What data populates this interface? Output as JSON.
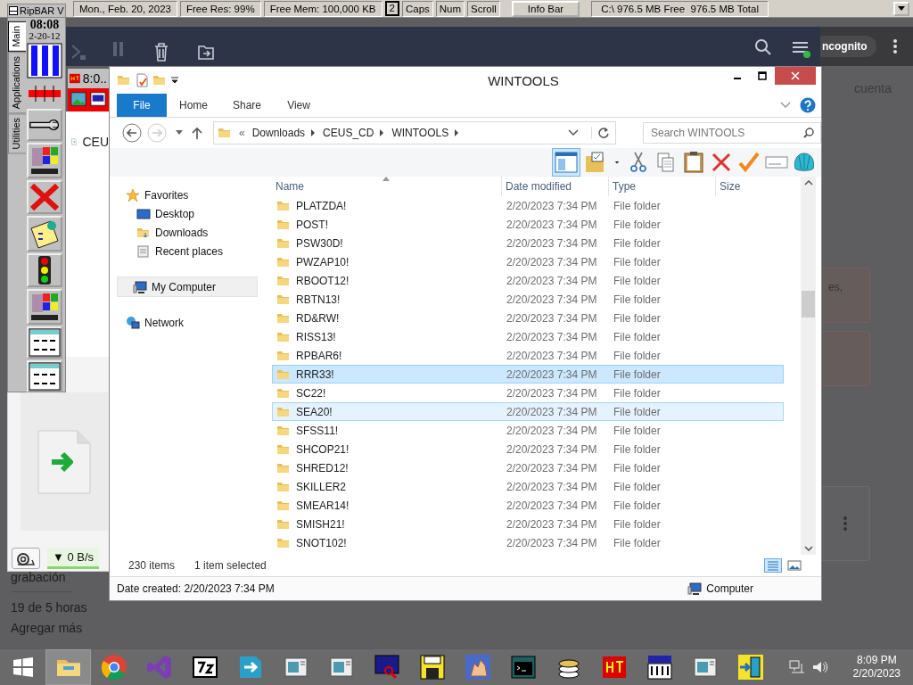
{
  "info_bar": {
    "segments": [
      {
        "text": "Mon., Feb. 20, 2023",
        "kind": "wide"
      },
      {
        "text": "Free Res: 99%",
        "kind": "wide"
      },
      {
        "text": "Free Mem: 100,000 KB",
        "kind": "wide"
      },
      {
        "text": "2",
        "kind": "counter"
      },
      {
        "text": "Caps",
        "kind": "key"
      },
      {
        "text": "Num",
        "kind": "key"
      },
      {
        "text": "Scroll",
        "kind": "key"
      },
      {
        "text": "Info Bar",
        "kind": "button"
      },
      {
        "text": "C:\\ 976.5 MB Free  976.5 MB Total",
        "kind": "wide"
      }
    ]
  },
  "background": {
    "incognito_label": "ncognito",
    "account_text": "cuenta",
    "card_text": "es,",
    "file_label": "CEU",
    "sidebar_texts": [
      "grabación",
      "19 de 5 horas",
      "Agregar más"
    ]
  },
  "hot_window": {
    "title": "8:0.."
  },
  "download_panel": {
    "speed": "▼ 0 B/s"
  },
  "ripbar": {
    "title": "RipBAR V",
    "clock": {
      "time": "08:08",
      "date": "2-20-12"
    },
    "tabs": [
      {
        "label": "Main",
        "selected": true
      },
      {
        "label": "Applications",
        "selected": false
      },
      {
        "label": "Utilities",
        "selected": false
      }
    ],
    "buttons": [
      {
        "kind": "meter"
      },
      {
        "kind": "redbar"
      },
      {
        "kind": "wrench"
      },
      {
        "kind": "windows"
      },
      {
        "kind": "cross"
      },
      {
        "kind": "note"
      },
      {
        "kind": "traffic"
      },
      {
        "kind": "windows"
      },
      {
        "kind": "form"
      },
      {
        "kind": "form"
      }
    ]
  },
  "explorer": {
    "title": "WINTOOLS",
    "ribbon_tabs": [
      {
        "label": "File",
        "selected": true
      },
      {
        "label": "Home",
        "selected": false
      },
      {
        "label": "Share",
        "selected": false
      },
      {
        "label": "View",
        "selected": false
      }
    ],
    "breadcrumb": [
      "«",
      "Downloads",
      "CEUS_CD",
      "WINTOOLS"
    ],
    "search_placeholder": "Search WINTOOLS",
    "nav": [
      {
        "label": "Favorites",
        "kind": "star",
        "selected": false,
        "children": [
          {
            "label": "Desktop",
            "kind": "desktop",
            "selected": false
          },
          {
            "label": "Downloads",
            "kind": "downloads",
            "selected": false
          },
          {
            "label": "Recent places",
            "kind": "recent",
            "selected": false
          }
        ]
      },
      {
        "label": "My Computer",
        "kind": "computer",
        "selected": true
      },
      {
        "label": "Network",
        "kind": "network",
        "selected": false
      }
    ],
    "columns": [
      "Name",
      "Date modified",
      "Type",
      "Size"
    ],
    "rows": [
      {
        "name": "PLATZDA!",
        "date": "2/20/2023 7:34 PM",
        "type": "File folder",
        "selected": false,
        "hovered": false
      },
      {
        "name": "POST!",
        "date": "2/20/2023 7:34 PM",
        "type": "File folder",
        "selected": false,
        "hovered": false
      },
      {
        "name": "PSW30D!",
        "date": "2/20/2023 7:34 PM",
        "type": "File folder",
        "selected": false,
        "hovered": false
      },
      {
        "name": "PWZAP10!",
        "date": "2/20/2023 7:34 PM",
        "type": "File folder",
        "selected": false,
        "hovered": false
      },
      {
        "name": "RBOOT12!",
        "date": "2/20/2023 7:34 PM",
        "type": "File folder",
        "selected": false,
        "hovered": false
      },
      {
        "name": "RBTN13!",
        "date": "2/20/2023 7:34 PM",
        "type": "File folder",
        "selected": false,
        "hovered": false
      },
      {
        "name": "RD&RW!",
        "date": "2/20/2023 7:34 PM",
        "type": "File folder",
        "selected": false,
        "hovered": false
      },
      {
        "name": "RISS13!",
        "date": "2/20/2023 7:34 PM",
        "type": "File folder",
        "selected": false,
        "hovered": false
      },
      {
        "name": "RPBAR6!",
        "date": "2/20/2023 7:34 PM",
        "type": "File folder",
        "selected": false,
        "hovered": false
      },
      {
        "name": "RRR33!",
        "date": "2/20/2023 7:34 PM",
        "type": "File folder",
        "selected": true,
        "hovered": false
      },
      {
        "name": "SC22!",
        "date": "2/20/2023 7:34 PM",
        "type": "File folder",
        "selected": false,
        "hovered": false
      },
      {
        "name": "SEA20!",
        "date": "2/20/2023 7:34 PM",
        "type": "File folder",
        "selected": false,
        "hovered": true
      },
      {
        "name": "SFSS11!",
        "date": "2/20/2023 7:34 PM",
        "type": "File folder",
        "selected": false,
        "hovered": false
      },
      {
        "name": "SHCOP21!",
        "date": "2/20/2023 7:34 PM",
        "type": "File folder",
        "selected": false,
        "hovered": false
      },
      {
        "name": "SHRED12!",
        "date": "2/20/2023 7:34 PM",
        "type": "File folder",
        "selected": false,
        "hovered": false
      },
      {
        "name": "SKILLER2",
        "date": "2/20/2023 7:34 PM",
        "type": "File folder",
        "selected": false,
        "hovered": false
      },
      {
        "name": "SMEAR14!",
        "date": "2/20/2023 7:34 PM",
        "type": "File folder",
        "selected": false,
        "hovered": false
      },
      {
        "name": "SMISH21!",
        "date": "2/20/2023 7:34 PM",
        "type": "File folder",
        "selected": false,
        "hovered": false
      },
      {
        "name": "SNOT102!",
        "date": "2/20/2023 7:34 PM",
        "type": "File folder",
        "selected": false,
        "hovered": false
      }
    ],
    "status": {
      "count": "230 items",
      "selection": "1 item selected"
    },
    "details": {
      "date_created": "Date created: 2/20/2023 7:34 PM",
      "location": "Computer"
    }
  },
  "taskbar": {
    "items": [
      {
        "kind": "explorer",
        "active": true
      },
      {
        "kind": "chrome",
        "active": false
      },
      {
        "kind": "vs",
        "active": false
      },
      {
        "kind": "sevenzip",
        "active": false
      },
      {
        "kind": "arrow",
        "active": false
      },
      {
        "kind": "window",
        "active": false
      },
      {
        "kind": "window",
        "active": false
      },
      {
        "kind": "monitor",
        "active": false
      },
      {
        "kind": "floppy",
        "active": false
      },
      {
        "kind": "hand",
        "active": false
      },
      {
        "kind": "terminal",
        "active": false
      },
      {
        "kind": "disks",
        "active": false
      },
      {
        "kind": "hot",
        "active": false
      },
      {
        "kind": "hours",
        "active": false
      },
      {
        "kind": "window",
        "active": false
      },
      {
        "kind": "exit",
        "active": false
      }
    ],
    "clock": {
      "time": "8:09 PM",
      "date": "2/20/2023"
    }
  }
}
